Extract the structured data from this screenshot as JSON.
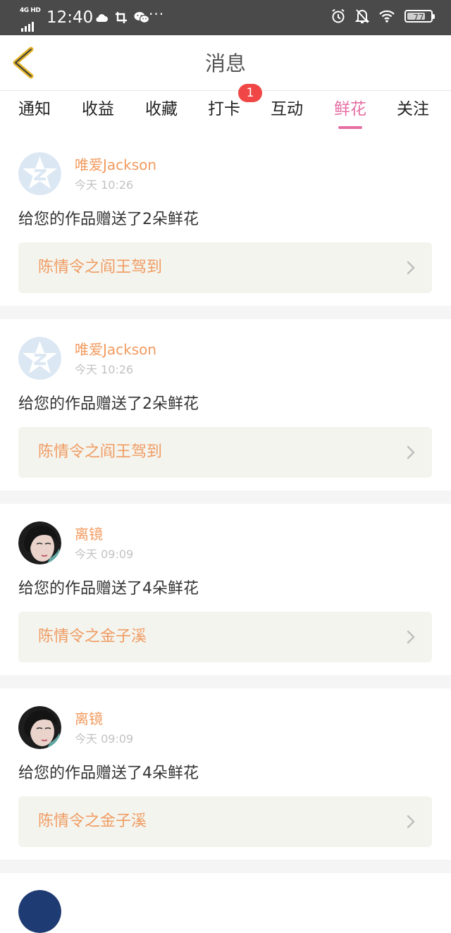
{
  "status_bar": {
    "network": "4G HD",
    "time": "12:40",
    "dots": "···",
    "battery": "77"
  },
  "header": {
    "title": "消息"
  },
  "tabs": [
    {
      "label": "通知",
      "active": false
    },
    {
      "label": "收益",
      "active": false
    },
    {
      "label": "收藏",
      "active": false
    },
    {
      "label": "打卡",
      "active": false
    },
    {
      "label": "互动",
      "active": false
    },
    {
      "label": "鲜花",
      "active": true
    },
    {
      "label": "关注",
      "active": false
    }
  ],
  "badge": {
    "count": "1"
  },
  "feed": [
    {
      "username": "唯爱Jackson",
      "time": "今天 10:26",
      "message": "给您的作品赠送了2朵鲜花",
      "work_title": "陈情令之阎王驾到",
      "avatar": "default-star-avatar"
    },
    {
      "username": "唯爱Jackson",
      "time": "今天 10:26",
      "message": "给您的作品赠送了2朵鲜花",
      "work_title": "陈情令之阎王驾到",
      "avatar": "default-star-avatar"
    },
    {
      "username": "离镜",
      "time": "今天 09:09",
      "message": "给您的作品赠送了4朵鲜花",
      "work_title": "陈情令之金子溪",
      "avatar": "portrait-avatar"
    },
    {
      "username": "离镜",
      "time": "今天 09:09",
      "message": "给您的作品赠送了4朵鲜花",
      "work_title": "陈情令之金子溪",
      "avatar": "portrait-avatar"
    }
  ],
  "colors": {
    "accent_pink": "#e56fa3",
    "username_orange": "#f29a5f",
    "work_title_orange": "#ef9b62",
    "badge_red": "#f04646",
    "back_arrow": "#e2b32a"
  }
}
